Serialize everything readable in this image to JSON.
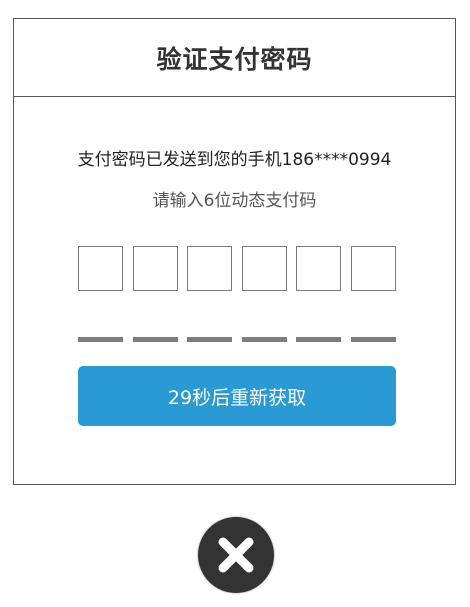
{
  "dialog": {
    "title": "验证支付密码",
    "sent_message": "支付密码已发送到您的手机186****0994",
    "input_hint": "请输入6位动态支付码",
    "code_slots": [
      "",
      "",
      "",
      "",
      "",
      ""
    ],
    "resend_label": "29秒后重新获取"
  },
  "close_icon": "close-icon",
  "colors": {
    "button": "#2a9ad5",
    "close_button": "#333333",
    "border": "#555555"
  }
}
